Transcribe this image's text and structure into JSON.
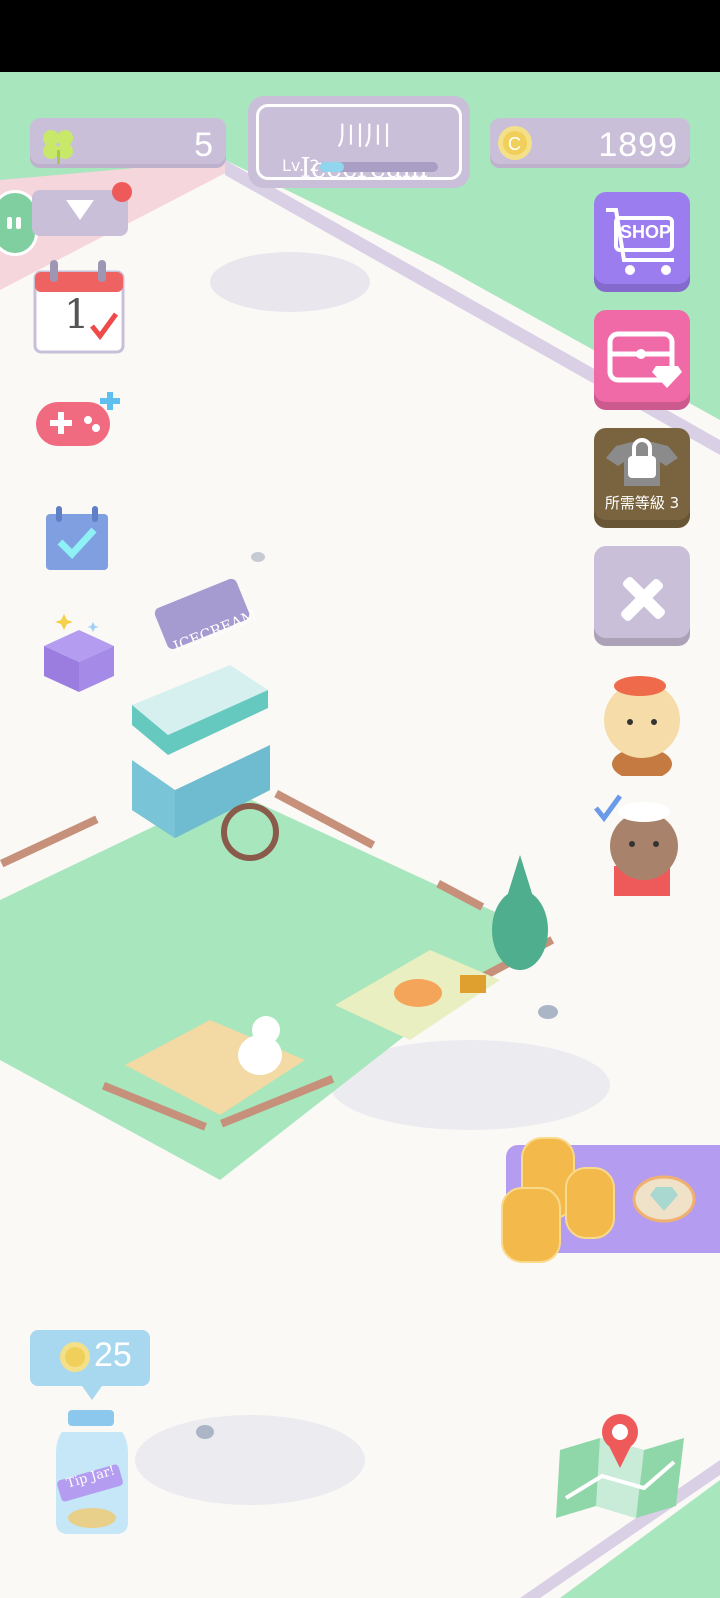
{
  "hud": {
    "clover_count": "5",
    "store_name": "川川 Icecream",
    "level_label": "Lv. 2",
    "level_progress": 0.2,
    "coins": "1899"
  },
  "right_menu": {
    "shop_label": "SHOP",
    "locked_label": "所需等級 3"
  },
  "calendar": {
    "day": "1"
  },
  "cart_sign": "ICECREAM",
  "tip_jar": {
    "coin_amount": "25",
    "jar_label": "Tip Jar!"
  },
  "colors": {
    "hud_pill": "#c9bfd8",
    "grass": "#a8e6bd",
    "shop_button": "#9b7df0",
    "chest_button": "#f06aa8",
    "locked_button": "#7a6440",
    "tools_button": "#c9bfd8",
    "offer_panel": "#b49cf0"
  },
  "icons": [
    "clover-icon",
    "coin-icon",
    "dropdown-icon",
    "notification-dot",
    "calendar-icon",
    "gamepad-plus-icon",
    "checklist-icon",
    "gift-box-icon",
    "shop-cart-icon",
    "treasure-chest-icon",
    "locked-shirt-icon",
    "tools-icon",
    "poodle-chef-avatar",
    "cat-chef-avatar",
    "coin-stack-icon",
    "diamond-icon",
    "tip-jar-icon",
    "map-icon",
    "side-toggle-icon"
  ]
}
